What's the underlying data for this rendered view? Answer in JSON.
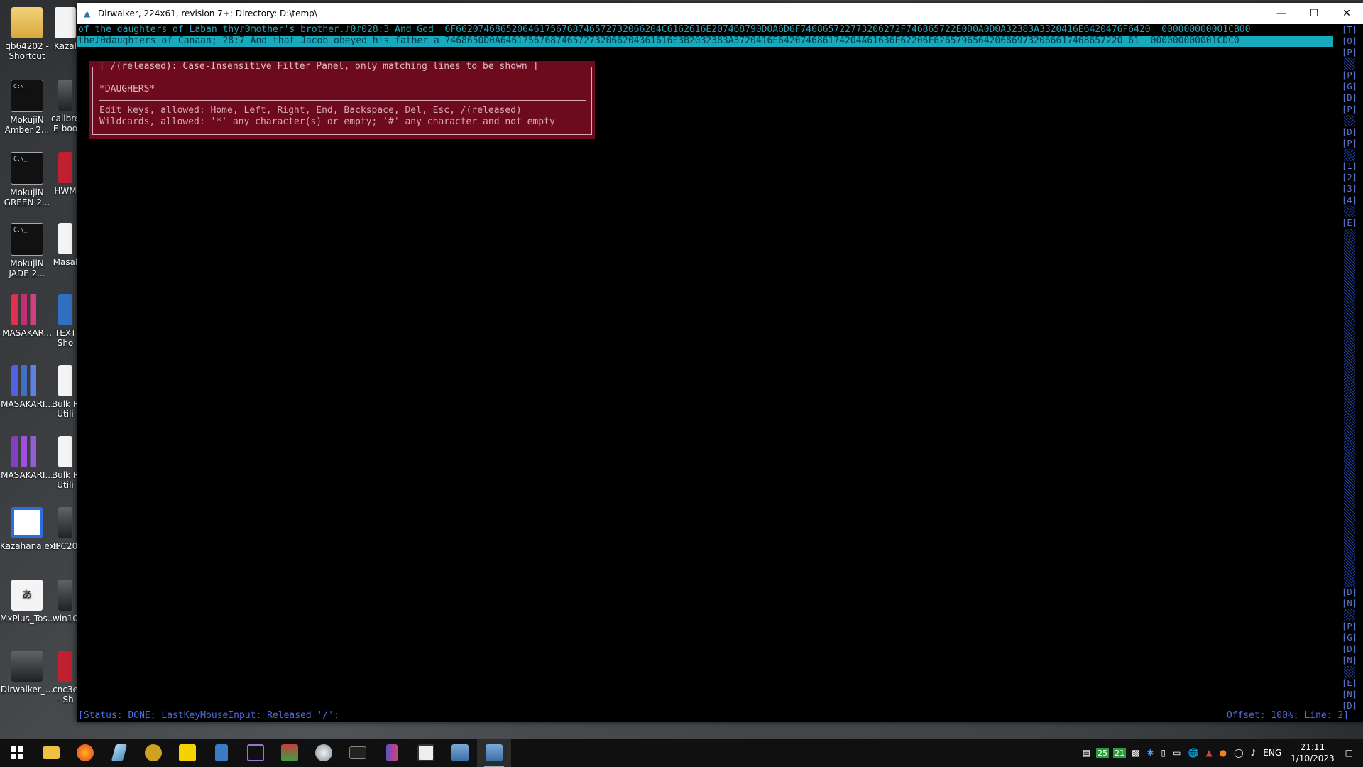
{
  "desktop": {
    "icons": [
      {
        "label": "qb64202 - Shortcut"
      },
      {
        "label": "Kazal"
      },
      {
        "label": "MokujiN Amber 2..."
      },
      {
        "label": "calibre E-boo"
      },
      {
        "label": "MokujiN GREEN 2..."
      },
      {
        "label": "HWM"
      },
      {
        "label": "MokujiN JADE 2..."
      },
      {
        "label": "Masal"
      },
      {
        "label": "MASAKAR..."
      },
      {
        "label": "TEXT Sho"
      },
      {
        "label": "MASAKARI..."
      },
      {
        "label": "Bulk R Utili"
      },
      {
        "label": "MASAKARI..."
      },
      {
        "label": "Bulk R Utili"
      },
      {
        "label": "Kazahana.exe"
      },
      {
        "label": "IPC20"
      },
      {
        "label": "MxPlus_Tos..."
      },
      {
        "label": "win10"
      },
      {
        "label": "Dirwalker_..."
      },
      {
        "label": "cnc3e - Sh"
      }
    ]
  },
  "window": {
    "title": "Dirwalker, 224x61, revision 7+; Directory: D:\\temp\\",
    "minimize": "—",
    "maximize": "☐",
    "close": "✕"
  },
  "console": {
    "lines": [
      "of the daughters of Laban thy♪0mother's brother.♪0♪028:3 And God  6F6620746865206461756768746572732066204C6162616E207468790D0A6D6F746865722773206272F746865722E0D0A0D0A32383A3320416E6420476F6420  000000000001CB00",
      "the♪0daughters of Canaan; 28:7 And that Jacob obeyed his father a 7468650D0A6461756768746572732066204361616E3B2032383A3720416E642074686174204A61636F62206F6265796564206869732066617468657220 61  000000000001CDC0"
    ]
  },
  "filter_panel": {
    "title": "[ /(released): Case-Insensitive Filter Panel, only matching lines to be shown ]",
    "value": "*DAUGHERS*",
    "help_1": "Edit keys, allowed: Home, Left, Right, End, Backspace, Del, Esc, /(released)",
    "help_2": "Wildcards, allowed: '*' any character(s) or empty; '#' any character and not empty"
  },
  "scrollbar": {
    "bookmarks_top": [
      "[T]",
      "[O]",
      "[P]",
      "[P]",
      "[G]",
      "[D]",
      "[P]",
      "[D]",
      "[P]",
      "[1]",
      "[2]",
      "[3]",
      "[4]",
      "[E]"
    ],
    "bookmarks_bottom": [
      "[D]",
      "[N]",
      "[P]",
      "[G]",
      "[D]",
      "[N]",
      "[E]",
      "[N]",
      "[D]"
    ]
  },
  "status": {
    "left": "[Status: DONE; LastKeyMouseInput: Released '/';",
    "right": "Offset: 100%; Line: 2]"
  },
  "taskbar": {
    "tray": {
      "badge_1": "25",
      "badge_2": "21",
      "lang": "ENG",
      "time": "21:11",
      "date": "1/10/2023"
    }
  },
  "colors": {
    "console_text": "#27a2b5",
    "highlight_bg": "#18a9bd",
    "panel_bg": "#6e0a1e",
    "status_text": "#4f6de0"
  }
}
